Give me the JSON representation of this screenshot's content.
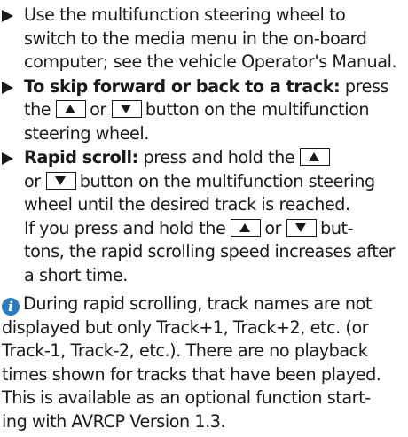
{
  "steps": [
    {
      "lines": [
        "Use the multifunction steering wheel to",
        "switch to the media menu in the on-board",
        "computer; see the vehicle Operator's Manual."
      ]
    },
    {
      "bold": "To skip forward or back to a track:",
      "after_bold": " press",
      "line2_pre": "the",
      "line2_mid": "or",
      "line2_post": "button on the multifunction",
      "line3": "steering wheel."
    },
    {
      "bold": "Rapid scroll:",
      "after_bold": " press and hold the",
      "line2_pre": "or",
      "line2_post": "button on the multifunction steering",
      "line3": "wheel until the desired track is reached.",
      "line4_pre": "If you press and hold the",
      "line4_mid": "or",
      "line4_post": "but-",
      "line5": "tons, the rapid scrolling speed increases after",
      "line6": "a short time."
    }
  ],
  "keys": {
    "up": "up-arrow-key",
    "down": "down-arrow-key"
  },
  "note": {
    "icon": "info-icon",
    "icon_glyph": "i",
    "icon_color": "#2b7bbe",
    "lines": [
      "During rapid scrolling, track names are not",
      "displayed but only Track+1, Track+2, etc. (or",
      "Track-1, Track-2, etc.). There are no playback",
      "times shown for tracks that have been played.",
      "This is available as an optional function start-",
      "ing with AVRCP Version 1.3."
    ]
  }
}
